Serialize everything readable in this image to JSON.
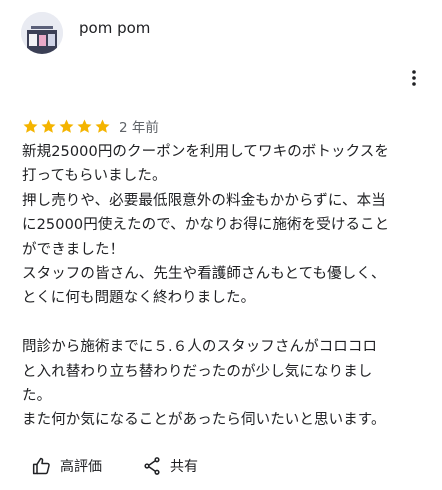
{
  "reviewer": {
    "name": "pom pom",
    "avatar_icon": "profile-photo"
  },
  "menu": {
    "icon": "more-vert-icon"
  },
  "review": {
    "rating": 5,
    "max_rating": 5,
    "star_color": "#f4b400",
    "date": "2 年前",
    "lines": [
      "新規25000円のクーポンを利用してワキのボトックスを",
      "打ってもらいました。",
      "押し売りや、必要最低限意外の料金もかからずに、本当",
      "に25000円使えたので、かなりお得に施術を受けること",
      "ができました！",
      "スタッフの皆さん、先生や看護師さんもとても優しく、",
      "とくに何も問題なく終わりました。",
      "",
      "問診から施術までに５.６人のスタッフさんがコロコロ",
      "と入れ替わり立ち替わりだったのが少し気になりまし",
      "た。",
      "また何か気になることがあったら伺いたいと思います。"
    ]
  },
  "actions": {
    "like_label": "高評価",
    "like_icon": "thumb-up-icon",
    "share_label": "共有",
    "share_icon": "share-icon"
  }
}
